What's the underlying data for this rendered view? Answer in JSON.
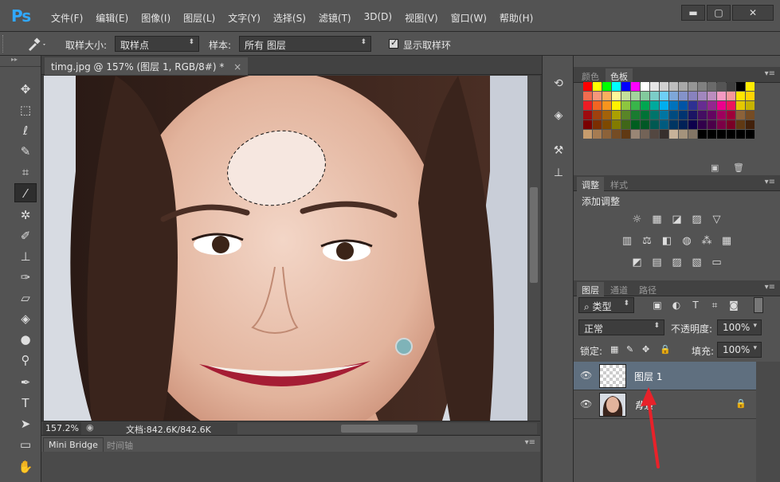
{
  "app": {
    "logo": "Ps",
    "menu": [
      "文件(F)",
      "编辑(E)",
      "图像(I)",
      "图层(L)",
      "文字(Y)",
      "选择(S)",
      "滤镜(T)",
      "3D(D)",
      "视图(V)",
      "窗口(W)",
      "帮助(H)"
    ],
    "window_controls": [
      "▬",
      "▢",
      "✕"
    ]
  },
  "options_bar": {
    "tool_icon": "eyedropper-icon",
    "sample_size_label": "取样大小:",
    "sample_size_value": "取样点",
    "sample_label": "样本:",
    "sample_value": "所有 图层",
    "show_ring_label": "显示取样环",
    "show_ring_checked": true
  },
  "document": {
    "tab_title": "timg.jpg @ 157% (图层 1, RGB/8#) *",
    "tab_close": "×",
    "zoom": "157.2%",
    "doc_info": "文档:842.6K/842.6K"
  },
  "bottom_panel": {
    "tabs": [
      "Mini Bridge",
      "时间轴"
    ]
  },
  "color_panel": {
    "tabs": [
      "颜色",
      "色板"
    ],
    "active_tab": "色板",
    "swatches": [
      "#ff0000",
      "#ffff00",
      "#00ff00",
      "#00ffff",
      "#0000ff",
      "#ff00ff",
      "#ffffff",
      "#e6e6e6",
      "#d0d0d0",
      "#bdbdbd",
      "#a8a8a8",
      "#959595",
      "#808080",
      "#6a6a6a",
      "#555555",
      "#3f3f3f",
      "#000000",
      "#ffeb00",
      "#f26c4f",
      "#f7977a",
      "#fbaf5d",
      "#fff79a",
      "#c4df9b",
      "#a3d39c",
      "#82ca9d",
      "#7bcdc8",
      "#6ecff6",
      "#7ea7d8",
      "#8493ca",
      "#8882be",
      "#a187be",
      "#bc8dbf",
      "#f49ac2",
      "#f6989d",
      "#ffe600",
      "#ffd400",
      "#ed1c24",
      "#f26522",
      "#f7941d",
      "#fff200",
      "#8dc63f",
      "#39b54a",
      "#00a651",
      "#00a99d",
      "#00aeef",
      "#0072bc",
      "#0054a6",
      "#2e3192",
      "#662d91",
      "#92278f",
      "#ec008c",
      "#ed145b",
      "#e4c800",
      "#c6b300",
      "#9e0b0f",
      "#a0410d",
      "#a36209",
      "#aba000",
      "#598527",
      "#1a7b30",
      "#007236",
      "#00746b",
      "#0076a3",
      "#004b80",
      "#003471",
      "#1b1464",
      "#440e62",
      "#630460",
      "#9e005d",
      "#9e0039",
      "#8c6239",
      "#754c24",
      "#790000",
      "#7b2e00",
      "#7d4900",
      "#827b00",
      "#406618",
      "#005e20",
      "#005826",
      "#005952",
      "#005b7f",
      "#003663",
      "#002157",
      "#0d004c",
      "#32004b",
      "#4b0049",
      "#7b0046",
      "#7a0026",
      "#603913",
      "#42210b",
      "#c69c6d",
      "#a67c52",
      "#8c6239",
      "#754c24",
      "#603913",
      "#998675",
      "#736357",
      "#534741",
      "#362f2d",
      "#c7b299",
      "#a4937c",
      "#827565",
      "#000000",
      "#000000",
      "#000000",
      "#000000",
      "#000000",
      "#000000"
    ],
    "footer_icons": [
      "new-swatch-icon",
      "trash-icon"
    ]
  },
  "adjustments_panel": {
    "tabs": [
      "调整",
      "样式"
    ],
    "active_tab": "调整",
    "title": "添加调整",
    "rows": [
      [
        "☼",
        "▦",
        "◪",
        "▨",
        "▽"
      ],
      [
        "▥",
        "⚖",
        "◧",
        "◍",
        "⁂",
        "▦"
      ],
      [
        "◩",
        "▤",
        "▨",
        "▧",
        "▭"
      ]
    ]
  },
  "layers_panel": {
    "tabs": [
      "图层",
      "通道",
      "路径"
    ],
    "active_tab": "图层",
    "filter_label": "类型",
    "filter_icons": [
      "▣",
      "◐",
      "T",
      "⌗",
      "◙"
    ],
    "blend_mode": "正常",
    "opacity_label": "不透明度:",
    "opacity_value": "100%",
    "lock_label": "锁定:",
    "lock_icons": [
      "▦",
      "✎",
      "✥",
      "🔒"
    ],
    "fill_label": "填充:",
    "fill_value": "100%",
    "layers": [
      {
        "name": "图层 1",
        "selected": true,
        "visible": true,
        "locked": false,
        "italic": false
      },
      {
        "name": "背景",
        "selected": false,
        "visible": true,
        "locked": true,
        "italic": true
      }
    ]
  },
  "colors": {
    "accent_blue": "#31a8ff",
    "annotation_red": "#e8222a",
    "selected_layer": "#5f6f7f"
  }
}
